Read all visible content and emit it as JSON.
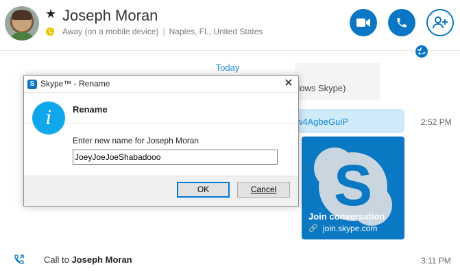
{
  "header": {
    "contact_name": "Joseph Moran",
    "status": "Away (on a mobile device)",
    "location": "Naples, FL, United States",
    "status_color": "#f3c200",
    "accent_color": "#0a76c4",
    "buttons": {
      "video_icon": "video-call-icon",
      "call_icon": "phone-icon",
      "add_icon": "add-person-icon",
      "globe_icon": "translate-globe-icon"
    }
  },
  "conversation": {
    "day_label": "Today",
    "notice_text": "dows Skype)",
    "link_text": "w4AgbeGuiP",
    "link_time": "2:52 PM",
    "card": {
      "title": "Join conversation",
      "url": "join.skype.com"
    },
    "call_prefix": "Call to",
    "call_name": "Joseph Moran",
    "call_time": "3:11 PM"
  },
  "dialog": {
    "title": "Skype™ - Rename",
    "heading": "Rename",
    "prompt": "Enter new name for Joseph Moran",
    "input_value": "JoeyJoeJoeShabadooo",
    "ok_label": "OK",
    "cancel_label": "Cancel"
  }
}
